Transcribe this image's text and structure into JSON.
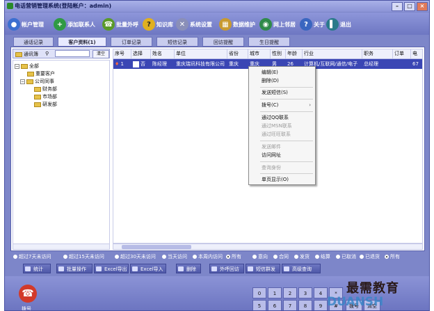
{
  "window": {
    "title": "电话营销管理系统(登陆帐户：admin)"
  },
  "toolbar": [
    {
      "label": "帐户管理",
      "icon": "user-icon"
    },
    {
      "label": "添加联系人",
      "icon": "add-contact-icon"
    },
    {
      "label": "批量外呼",
      "icon": "phone-icon"
    },
    {
      "label": "知识库",
      "icon": "help-icon"
    },
    {
      "label": "系统设置",
      "icon": "tools-icon"
    },
    {
      "label": "数据维护",
      "icon": "database-icon"
    },
    {
      "label": "网上邻居",
      "icon": "globe-icon"
    },
    {
      "label": "关于",
      "icon": "info-icon"
    },
    {
      "label": "退出",
      "icon": "exit-icon"
    }
  ],
  "tabs": [
    "通话记录",
    "客户资料(1)",
    "订单记录",
    "短信记录",
    "回访提醒",
    "生日提醒"
  ],
  "left": {
    "label": "通讯簿",
    "clear": "清空"
  },
  "tree": [
    "全部",
    "重要客户",
    "公司同事",
    "财务部",
    "市场部",
    "研发部"
  ],
  "grid": {
    "columns": [
      "序号",
      "选择",
      "姓名",
      "单位",
      "省份",
      "城市",
      "性别",
      "年龄",
      "行业",
      "职务",
      "订单",
      "电"
    ],
    "row": [
      "1",
      "否",
      "陈经理",
      "重庆瑞讯科技有限公司",
      "重庆",
      "重庆",
      "男",
      "26",
      "计算机/互联网/通信/电子",
      "总经理",
      "",
      "67"
    ]
  },
  "context_menu": [
    {
      "label": "编辑(E)",
      "enabled": true
    },
    {
      "label": "删除(D)",
      "enabled": true
    },
    {
      "label": "发送短信(S)",
      "enabled": true
    },
    {
      "label": "拨号(C)",
      "enabled": true
    },
    {
      "label": "通过QQ联系",
      "enabled": true
    },
    {
      "label": "通过MSN联系",
      "enabled": false
    },
    {
      "label": "通过旺旺联系",
      "enabled": false
    },
    {
      "label": "发送邮件",
      "enabled": false
    },
    {
      "label": "访问网址",
      "enabled": true
    },
    {
      "label": "查询身份",
      "enabled": false
    },
    {
      "label": "单页显示(O)",
      "enabled": true
    }
  ],
  "filters_left": [
    "超过7天未访问",
    "超过15天未访问",
    "超过30天未访问",
    "当天访问",
    "本周内访问",
    "所有"
  ],
  "filters_right": [
    "意向",
    "合同",
    "发货",
    "结算",
    "已取消",
    "已退货",
    "所有"
  ],
  "actions": [
    "统计",
    "批量操作",
    "Excel导出",
    "Excel导入",
    "删除",
    "外呼回访",
    "短信群发",
    "高级查询"
  ],
  "bottom": {
    "phone_label": "拨号",
    "keys_row1": [
      "0",
      "1",
      "2",
      "3",
      "4",
      "*"
    ],
    "keys_row2": [
      "5",
      "6",
      "7",
      "8",
      "9",
      "#"
    ],
    "dial": "拨号",
    "clear": "清空"
  },
  "watermark": {
    "line1": "最需教育",
    "line2": "DUANSH"
  }
}
